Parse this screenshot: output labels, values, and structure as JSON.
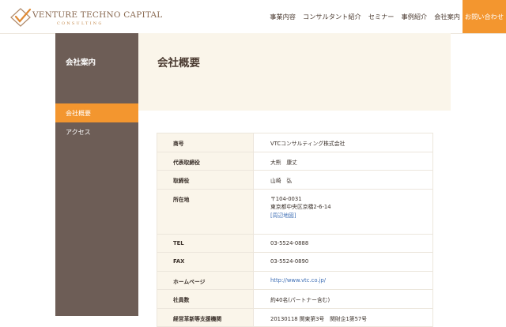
{
  "brand": {
    "name": "Venture Techno Capital",
    "sub": "CONSULTING"
  },
  "nav": {
    "items": [
      "事業内容",
      "コンサルタント紹介",
      "セミナー",
      "事例紹介",
      "会社案内"
    ],
    "contact": "お問い合わせ"
  },
  "sidebar": {
    "title": "会社案内",
    "items": [
      "会社概要",
      "アクセス"
    ]
  },
  "page": {
    "title": "会社概要"
  },
  "company": {
    "rows": [
      {
        "label": "商号",
        "value": "VTCコンサルティング株式会社"
      },
      {
        "label": "代表取締役",
        "value": "大熊　康丈"
      },
      {
        "label": "取締役",
        "value": "山崎　弘"
      },
      {
        "label": "所在地",
        "postal": "〒104-0031",
        "address": "東京都中央区京橋2-6-14",
        "map_link": "[周辺地図]"
      },
      {
        "label": "TEL",
        "value": "03-5524-0888"
      },
      {
        "label": "FAX",
        "value": "03-5524-0890"
      },
      {
        "label": "ホームページ",
        "value": "http://www.vtc.co.jp/"
      },
      {
        "label": "社員数",
        "value": "約40名(パートナー含む)"
      },
      {
        "label": "経営革新等支援機関",
        "value": "20130118 関東第3号　関財企1第57号"
      }
    ]
  },
  "colors": {
    "accent": "#f3962f",
    "sidebar": "#6d5d56",
    "band": "#faf5ea",
    "link": "#3f6fb5"
  },
  "icons": {
    "logo": "diamond-checkmark-logo-icon"
  }
}
